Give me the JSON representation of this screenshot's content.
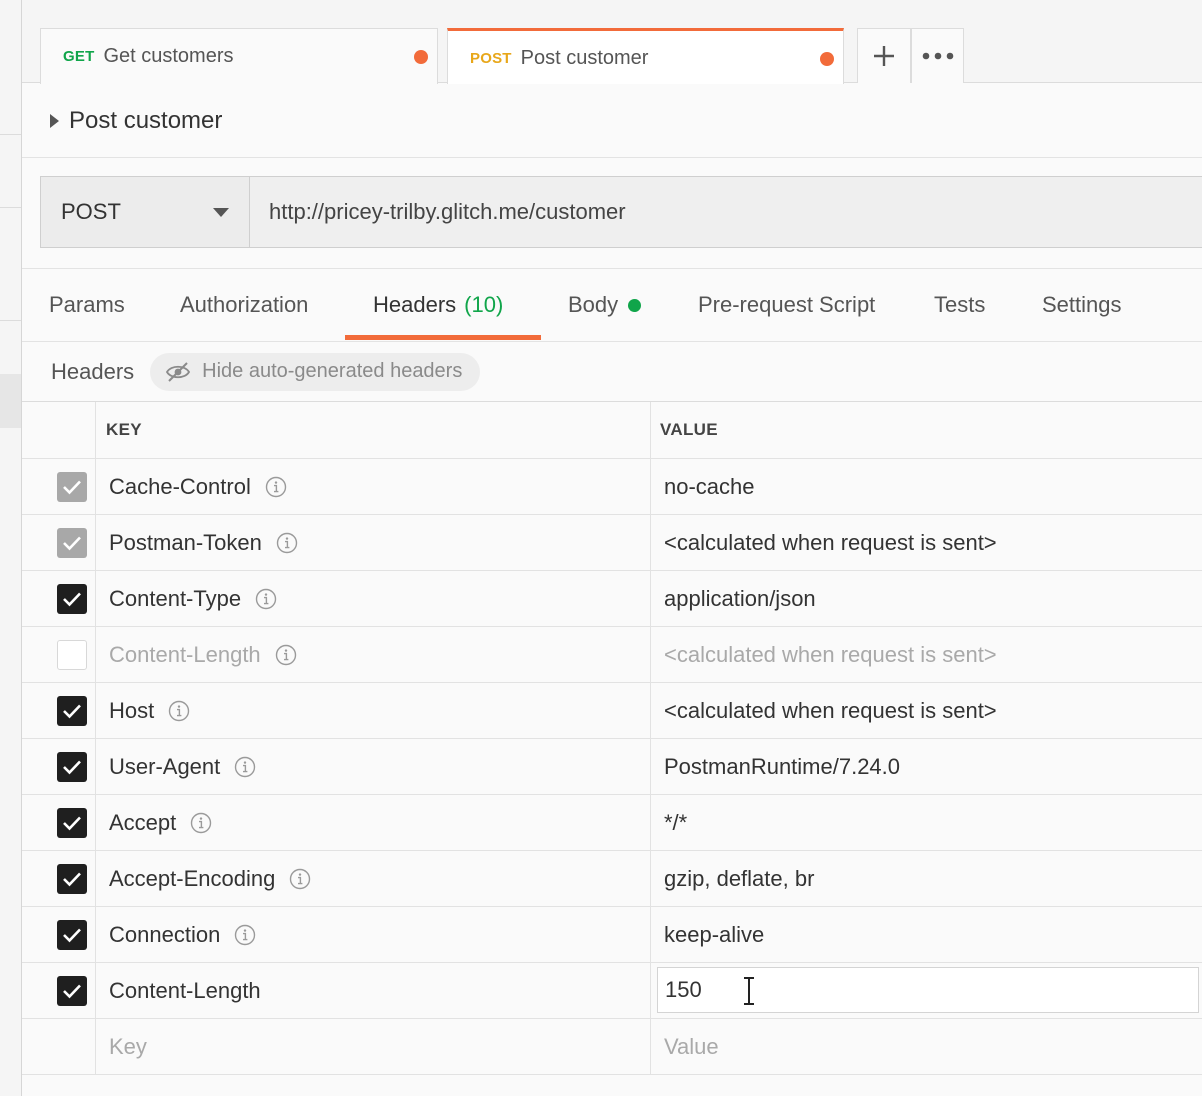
{
  "tabs": [
    {
      "method": "GET",
      "name": "Get customers",
      "unsaved": true,
      "active": false
    },
    {
      "method": "POST",
      "name": "Post customer",
      "unsaved": true,
      "active": true
    }
  ],
  "tab_actions": {
    "new_tab_icon": "plus-icon",
    "more_icon": "ellipsis-icon"
  },
  "request": {
    "title": "Post customer",
    "method": "POST",
    "url": "http://pricey-trilby.glitch.me/customer"
  },
  "subtabs": [
    {
      "label": "Params"
    },
    {
      "label": "Authorization"
    },
    {
      "label": "Headers",
      "count": "(10)",
      "active": true
    },
    {
      "label": "Body",
      "indicator": true
    },
    {
      "label": "Pre-request Script"
    },
    {
      "label": "Tests"
    },
    {
      "label": "Settings"
    }
  ],
  "headers_toolbar": {
    "title": "Headers",
    "hide_auto_label": "Hide auto-generated headers"
  },
  "table": {
    "columns": {
      "key": "KEY",
      "value": "VALUE"
    },
    "rows": [
      {
        "key": "Cache-Control",
        "value": "no-cache",
        "state": "auto",
        "info": true
      },
      {
        "key": "Postman-Token",
        "value": "<calculated when request is sent>",
        "state": "auto",
        "info": true
      },
      {
        "key": "Content-Type",
        "value": "application/json",
        "state": "on",
        "info": true
      },
      {
        "key": "Content-Length",
        "value": "<calculated when request is sent>",
        "state": "off",
        "info": true
      },
      {
        "key": "Host",
        "value": "<calculated when request is sent>",
        "state": "on",
        "info": true
      },
      {
        "key": "User-Agent",
        "value": "PostmanRuntime/7.24.0",
        "state": "on",
        "info": true
      },
      {
        "key": "Accept",
        "value": "*/*",
        "state": "on",
        "info": true
      },
      {
        "key": "Accept-Encoding",
        "value": "gzip, deflate, br",
        "state": "on",
        "info": true
      },
      {
        "key": "Connection",
        "value": "keep-alive",
        "state": "on",
        "info": true
      },
      {
        "key": "Content-Length",
        "value": "150",
        "state": "on",
        "info": false,
        "editing": true
      }
    ],
    "placeholder": {
      "key": "Key",
      "value": "Value"
    }
  },
  "colors": {
    "accent": "#f26b3a",
    "get": "#10a54a",
    "post": "#e8a71a",
    "count": "#10a54a"
  }
}
